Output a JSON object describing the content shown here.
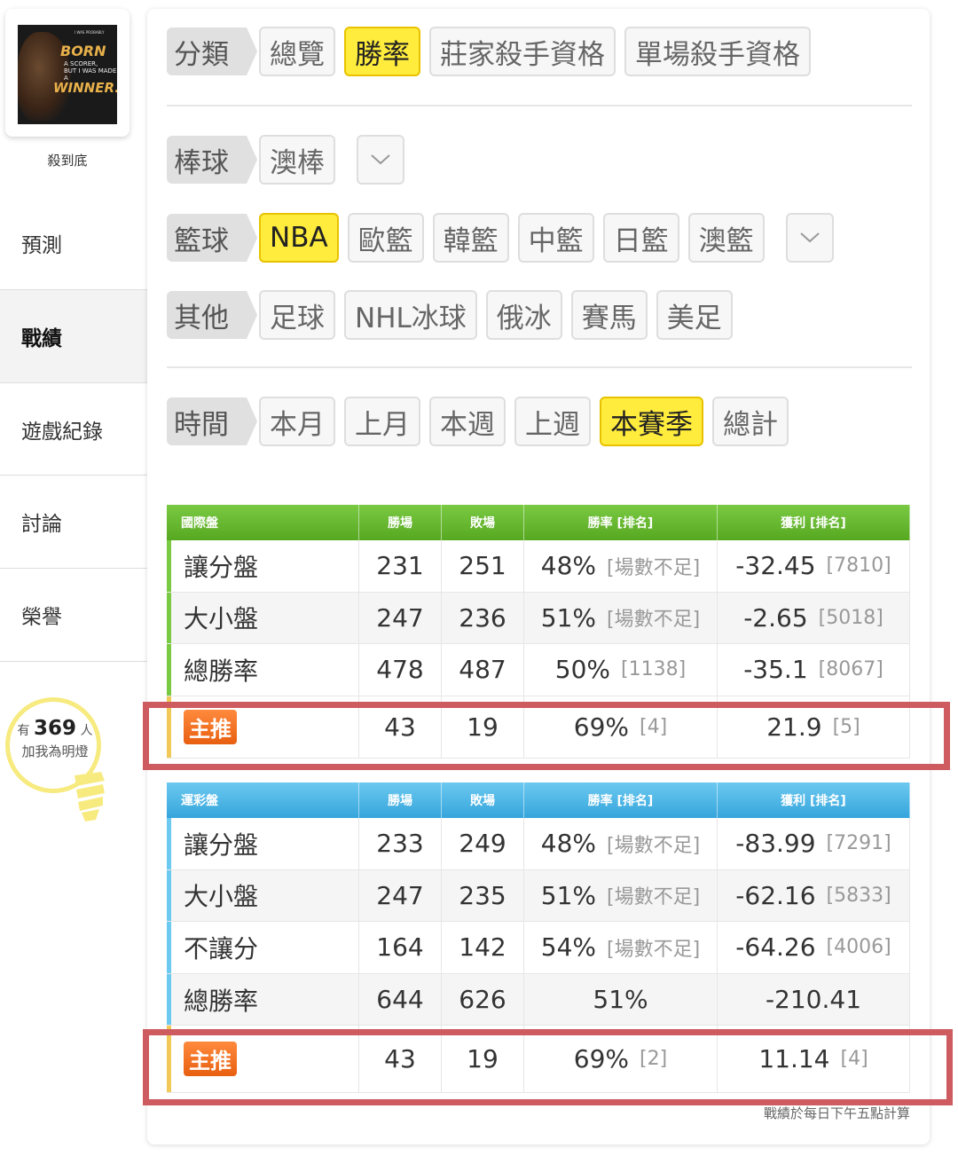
{
  "sidebar": {
    "avatar": {
      "line1": "I WAS PROBABLY",
      "line2": "BORN",
      "line3": "A SCORER,",
      "line4": "BUT I WAS MADE A",
      "line5": "WINNER."
    },
    "username": "殺到底",
    "items": [
      {
        "label": "預測"
      },
      {
        "label": "戰績"
      },
      {
        "label": "遊戲紀錄"
      },
      {
        "label": "討論"
      },
      {
        "label": "榮譽"
      }
    ],
    "fans": {
      "prefix": "有",
      "count": "369",
      "suffix": "人",
      "text": "加我為明燈"
    }
  },
  "filters": {
    "category": {
      "label": "分類",
      "options": [
        "總覽",
        "勝率",
        "莊家殺手資格",
        "單場殺手資格"
      ],
      "selected": "勝率"
    },
    "baseball": {
      "label": "棒球",
      "options": [
        "澳棒"
      ]
    },
    "basketball": {
      "label": "籃球",
      "options": [
        "NBA",
        "歐籃",
        "韓籃",
        "中籃",
        "日籃",
        "澳籃"
      ],
      "selected": "NBA"
    },
    "other": {
      "label": "其他",
      "options": [
        "足球",
        "NHL冰球",
        "俄冰",
        "賽馬",
        "美足"
      ]
    },
    "time": {
      "label": "時間",
      "options": [
        "本月",
        "上月",
        "本週",
        "上週",
        "本賽季",
        "總計"
      ],
      "selected": "本賽季"
    }
  },
  "international": {
    "headers": [
      "國際盤",
      "勝場",
      "敗場",
      "勝率 [排名]",
      "獲利 [排名]"
    ],
    "rows": [
      {
        "type": "讓分盤",
        "win": "231",
        "loss": "251",
        "rate": "48%",
        "rate_rank": "[場數不足]",
        "profit": "-32.45",
        "profit_rank": "[7810]"
      },
      {
        "type": "大小盤",
        "win": "247",
        "loss": "236",
        "rate": "51%",
        "rate_rank": "[場數不足]",
        "profit": "-2.65",
        "profit_rank": "[5018]"
      },
      {
        "type": "總勝率",
        "win": "478",
        "loss": "487",
        "rate": "50%",
        "rate_rank": "[1138]",
        "profit": "-35.1",
        "profit_rank": "[8067]"
      }
    ],
    "main": {
      "badge": "主推",
      "win": "43",
      "loss": "19",
      "rate": "69%",
      "rate_rank": "[4]",
      "profit": "21.9",
      "profit_rank": "[5]"
    }
  },
  "sports_lottery": {
    "headers": [
      "運彩盤",
      "勝場",
      "敗場",
      "勝率 [排名]",
      "獲利 [排名]"
    ],
    "rows": [
      {
        "type": "讓分盤",
        "win": "233",
        "loss": "249",
        "rate": "48%",
        "rate_rank": "[場數不足]",
        "profit": "-83.99",
        "profit_rank": "[7291]"
      },
      {
        "type": "大小盤",
        "win": "247",
        "loss": "235",
        "rate": "51%",
        "rate_rank": "[場數不足]",
        "profit": "-62.16",
        "profit_rank": "[5833]"
      },
      {
        "type": "不讓分",
        "win": "164",
        "loss": "142",
        "rate": "54%",
        "rate_rank": "[場數不足]",
        "profit": "-64.26",
        "profit_rank": "[4006]"
      },
      {
        "type": "總勝率",
        "win": "644",
        "loss": "626",
        "rate": "51%",
        "rate_rank": "",
        "profit": "-210.41",
        "profit_rank": ""
      }
    ],
    "main": {
      "badge": "主推",
      "win": "43",
      "loss": "19",
      "rate": "69%",
      "rate_rank": "[2]",
      "profit": "11.14",
      "profit_rank": "[4]"
    }
  },
  "note": "戰績於每日下午五點計算",
  "colors": {
    "selected": "#ffec3d",
    "green_header": "#7ac943",
    "blue_header": "#35a5dc",
    "highlight": "#cd5b5f",
    "badge": "#e85f10"
  }
}
